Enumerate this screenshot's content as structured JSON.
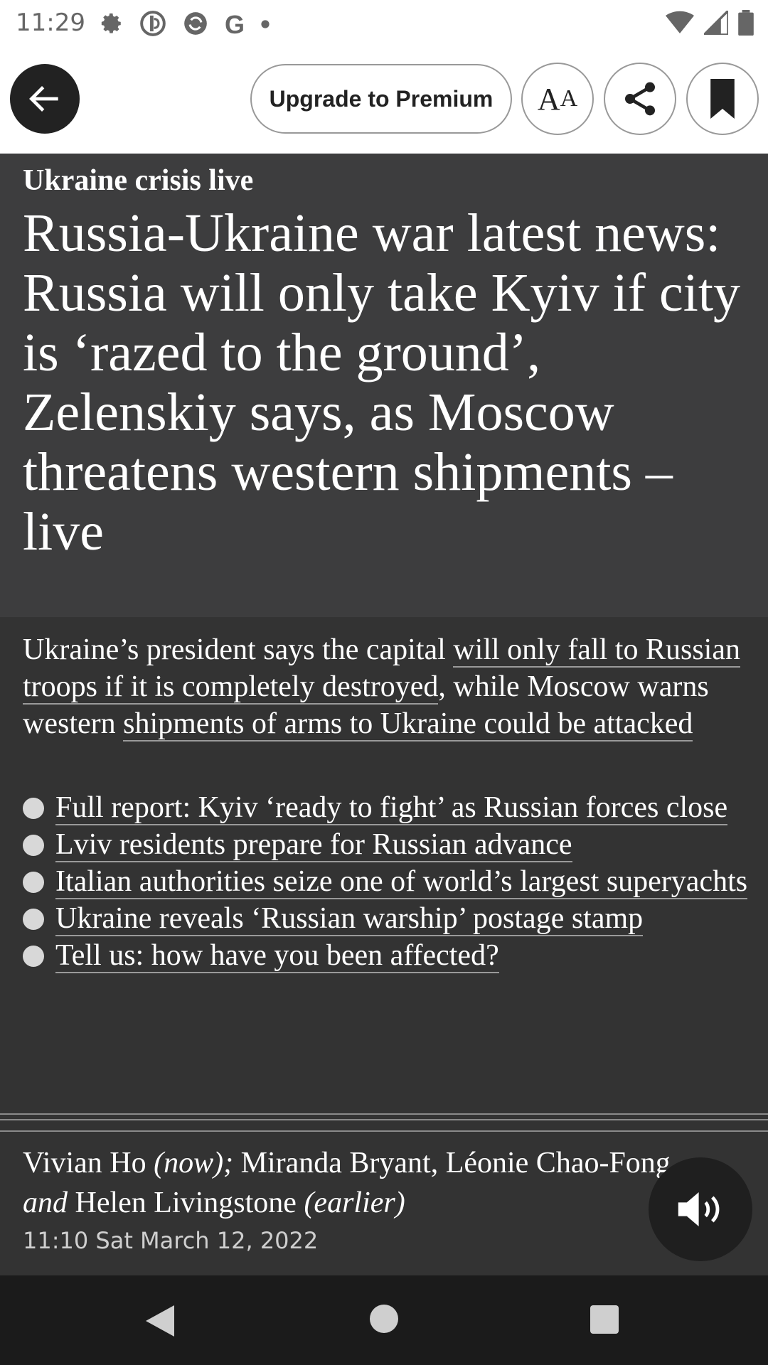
{
  "status_bar": {
    "time": "11:29",
    "icons": [
      "settings-icon",
      "news-app-icon",
      "sync-icon",
      "google-icon",
      "dot-icon"
    ],
    "right_icons": [
      "wifi-icon",
      "signal-icon",
      "battery-icon"
    ]
  },
  "toolbar": {
    "premium_label": "Upgrade to Premium",
    "font_size_big": "A",
    "font_size_small": "A"
  },
  "article": {
    "kicker": "Ukraine crisis live",
    "headline": "Russia-Ukraine war latest news: Russia will only take Kyiv if city is ‘razed to the ground’, Zelenskiy says, as Moscow threatens western shipments – live",
    "standfirst_part1": "Ukraine’s president says the capital ",
    "standfirst_link1": "will only fall to Russian troops if it is completely destroyed",
    "standfirst_part2": ", while Moscow warns western ",
    "standfirst_link2": "shipments of arms to Ukraine could be attacked",
    "bullets": [
      "Full report: Kyiv ‘ready to fight’ as Russian forces close",
      "Lviv residents prepare for Russian advance",
      "Italian authorities seize one of world’s largest superyachts",
      "Ukraine reveals ‘Russian warship’ postage stamp",
      "Tell us: how have you been affected?"
    ],
    "byline_author1": "Vivian Ho",
    "byline_now": "(now);",
    "byline_authors2": "Miranda Bryant, Léonie Chao-Fong",
    "byline_and": "and",
    "byline_author3": "Helen Livingstone",
    "byline_earlier": "(earlier)",
    "dateline": "11:10 Sat March 12, 2022"
  }
}
